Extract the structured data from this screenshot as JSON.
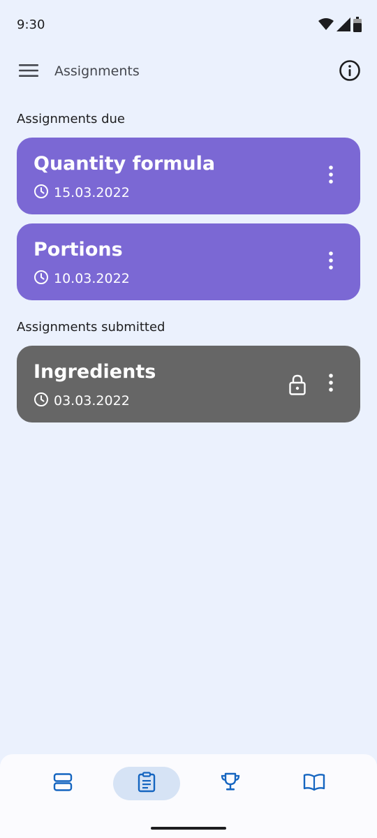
{
  "status_bar": {
    "time": "9:30"
  },
  "app_bar": {
    "title": "Assignments"
  },
  "sections": {
    "due_label": "Assignments due",
    "submitted_label": "Assignments submitted"
  },
  "assignments_due": [
    {
      "title": "Quantity formula",
      "date": "15.03.2022"
    },
    {
      "title": "Portions",
      "date": "10.03.2022"
    }
  ],
  "assignments_submitted": [
    {
      "title": "Ingredients",
      "date": "03.03.2022",
      "locked": true
    }
  ],
  "bottom_nav": {
    "items": [
      {
        "icon": "view-agenda-icon",
        "active": false
      },
      {
        "icon": "assignment-icon",
        "active": true
      },
      {
        "icon": "trophy-icon",
        "active": false
      },
      {
        "icon": "book-icon",
        "active": false
      }
    ]
  },
  "colors": {
    "background": "#ebf1fd",
    "due_card": "#7b68d4",
    "submitted_card": "#666666",
    "nav_accent": "#1565c0",
    "nav_active_pill": "#d6e3f5"
  }
}
